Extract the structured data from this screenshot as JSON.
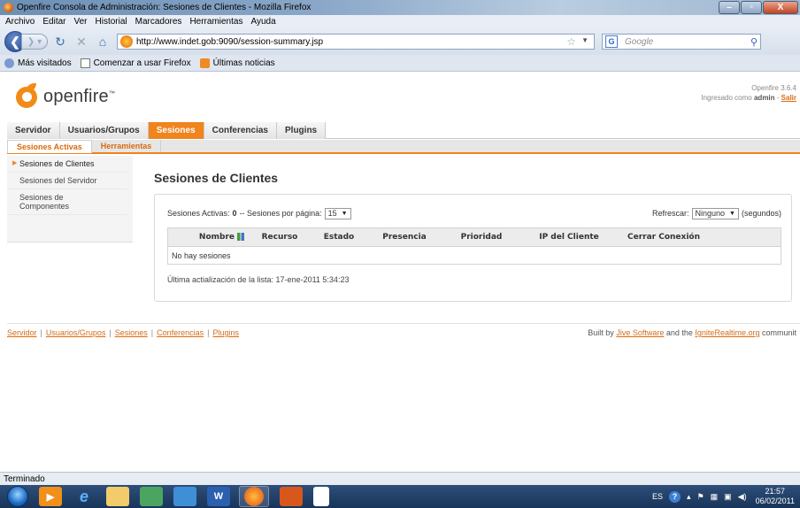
{
  "window": {
    "title": "Openfire Consola de Administración: Sesiones de Clientes - Mozilla Firefox",
    "min_label": "–",
    "max_label": "▫",
    "close_label": "X"
  },
  "menu": [
    "Archivo",
    "Editar",
    "Ver",
    "Historial",
    "Marcadores",
    "Herramientas",
    "Ayuda"
  ],
  "nav": {
    "url": "http://www.indet.gob:9090/session-summary.jsp",
    "search_engine": "G",
    "search_placeholder": "Google"
  },
  "bookmarks": [
    "Más visitados",
    "Comenzar a usar Firefox",
    "Últimas noticias"
  ],
  "header": {
    "logo_text": "openfire",
    "logo_tm": "™",
    "version": "Openfire 3.6.4",
    "logged_in_prefix": "Ingresado como",
    "user": "admin",
    "logout": "Salir"
  },
  "main_tabs": [
    {
      "label": "Servidor",
      "active": false
    },
    {
      "label": "Usuarios/Grupos",
      "active": false
    },
    {
      "label": "Sesiones",
      "active": true
    },
    {
      "label": "Conferencias",
      "active": false
    },
    {
      "label": "Plugins",
      "active": false
    }
  ],
  "sub_tabs": [
    {
      "label": "Sesiones Activas",
      "active": true
    },
    {
      "label": "Herramientas",
      "active": false
    }
  ],
  "sidebar": [
    {
      "label": "Sesiones de Clientes",
      "active": true
    },
    {
      "label": "Sesiones del Servidor",
      "active": false
    },
    {
      "label": "Sesiones de Componentes",
      "active": false
    }
  ],
  "content": {
    "title": "Sesiones de Clientes",
    "active_sessions_label": "Sesiones Activas:",
    "active_sessions_count": "0",
    "per_page_label": "-- Sesiones por página:",
    "per_page_value": "15",
    "refresh_label": "Refrescar:",
    "refresh_value": "Ninguno",
    "refresh_unit": "(segundos)",
    "table": {
      "headers": [
        "Nombre",
        "Recurso",
        "Estado",
        "Presencia",
        "Prioridad",
        "IP del Cliente",
        "Cerrar Conexión"
      ],
      "empty_message": "No hay sesiones"
    },
    "last_update": "Última actialización de la lista: 17-ene-2011 5:34:23"
  },
  "footer": {
    "links": [
      "Servidor",
      "Usuarios/Grupos",
      "Sesiones",
      "Conferencias",
      "Plugins"
    ],
    "built_by_prefix": "Built by",
    "jive": "Jive Software",
    "built_by_mid": "and the",
    "ignite": "IgniteRealtime.org",
    "built_by_suffix": "communit"
  },
  "status": "Terminado",
  "taskbar": {
    "lang": "ES",
    "time": "21:57",
    "date": "06/02/2011"
  }
}
